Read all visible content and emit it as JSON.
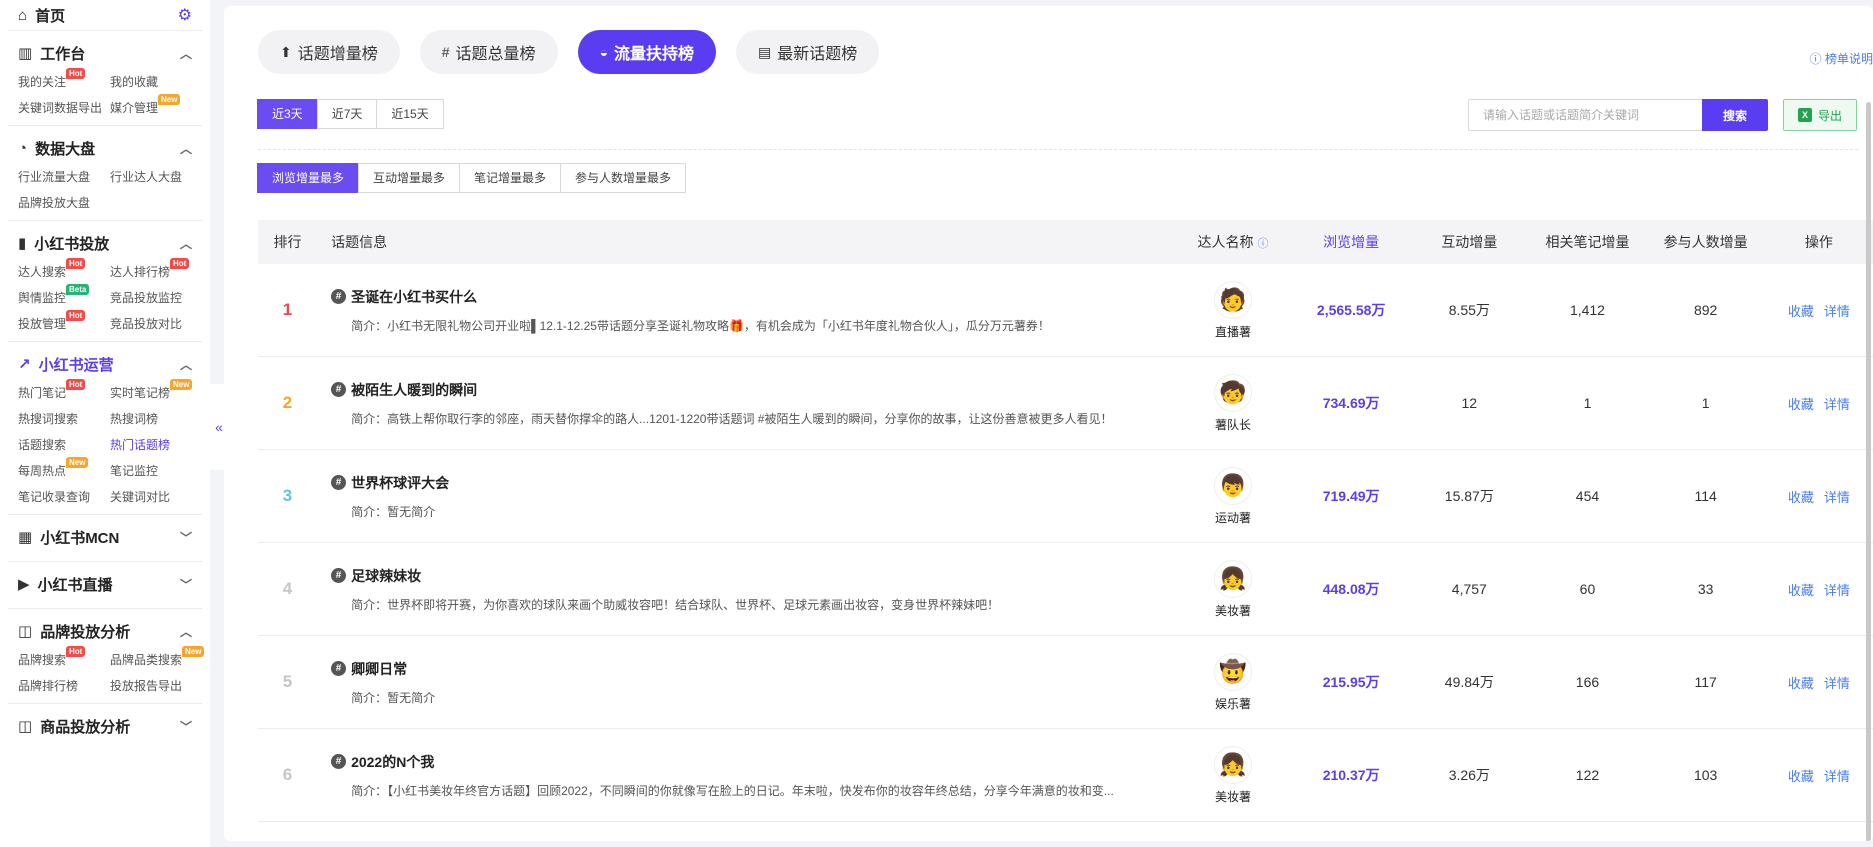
{
  "sidebar": {
    "home": "首页",
    "sections": [
      {
        "title": "工作台",
        "icon": "chart-bars-icon",
        "expanded": true,
        "items": [
          {
            "label": "我的关注",
            "tag": "Hot"
          },
          {
            "label": "我的收藏",
            "tag": ""
          },
          {
            "label": "关键词数据导出",
            "tag": ""
          },
          {
            "label": "媒介管理",
            "tag": "New"
          }
        ]
      },
      {
        "title": "数据大盘",
        "icon": "pie-chart-icon",
        "expanded": true,
        "items": [
          {
            "label": "行业流量大盘",
            "tag": ""
          },
          {
            "label": "行业达人大盘",
            "tag": ""
          },
          {
            "label": "品牌投放大盘",
            "tag": ""
          }
        ]
      },
      {
        "title": "小红书投放",
        "icon": "bar-chart-icon",
        "expanded": true,
        "items": [
          {
            "label": "达人搜索",
            "tag": "Hot"
          },
          {
            "label": "达人排行榜",
            "tag": "Hot"
          },
          {
            "label": "舆情监控",
            "tag": "Beta"
          },
          {
            "label": "竞品投放监控",
            "tag": ""
          },
          {
            "label": "投放管理",
            "tag": "Hot"
          },
          {
            "label": "竞品投放对比",
            "tag": ""
          }
        ]
      },
      {
        "title": "小红书运营",
        "icon": "trend-icon",
        "expanded": true,
        "active": true,
        "items": [
          {
            "label": "热门笔记",
            "tag": "Hot"
          },
          {
            "label": "实时笔记榜",
            "tag": "New"
          },
          {
            "label": "热搜词搜索",
            "tag": ""
          },
          {
            "label": "热搜词榜",
            "tag": ""
          },
          {
            "label": "话题搜索",
            "tag": ""
          },
          {
            "label": "热门话题榜",
            "tag": "",
            "active": true
          },
          {
            "label": "每周热点",
            "tag": "New"
          },
          {
            "label": "笔记监控",
            "tag": ""
          },
          {
            "label": "笔记收录查询",
            "tag": ""
          },
          {
            "label": "关键词对比",
            "tag": ""
          }
        ]
      },
      {
        "title": "小红书MCN",
        "icon": "grid-icon",
        "expanded": false,
        "items": []
      },
      {
        "title": "小红书直播",
        "icon": "video-icon",
        "expanded": false,
        "items": []
      },
      {
        "title": "品牌投放分析",
        "icon": "bag-icon",
        "expanded": true,
        "items": [
          {
            "label": "品牌搜索",
            "tag": "Hot"
          },
          {
            "label": "品牌品类搜索",
            "tag": "New"
          },
          {
            "label": "品牌排行榜",
            "tag": ""
          },
          {
            "label": "投放报告导出",
            "tag": ""
          }
        ]
      },
      {
        "title": "商品投放分析",
        "icon": "shop-icon",
        "expanded": false,
        "items": []
      }
    ]
  },
  "tabs": [
    {
      "label": "话题增量榜",
      "icon": "arrow-up-circle-icon",
      "active": false
    },
    {
      "label": "话题总量榜",
      "icon": "hash-icon",
      "active": false
    },
    {
      "label": "流量扶持榜",
      "icon": "half-circle-icon",
      "active": true
    },
    {
      "label": "最新话题榜",
      "icon": "chat-icon",
      "active": false
    }
  ],
  "rank_help": "榜单说明",
  "day_filters": [
    "近3天",
    "近7天",
    "近15天"
  ],
  "sort_filters": [
    "浏览增量最多",
    "互动增量最多",
    "笔记增量最多",
    "参与人数增量最多"
  ],
  "search": {
    "placeholder": "请输入话题或话题简介关键词",
    "button": "搜索"
  },
  "export_label": "导出",
  "table": {
    "headers": {
      "rank": "排行",
      "topic": "话题信息",
      "user": "达人名称",
      "views": "浏览增量",
      "interact": "互动增量",
      "notes": "相关笔记增量",
      "people": "参与人数增量",
      "op": "操作"
    },
    "ops": {
      "fav": "收藏",
      "detail": "详情"
    },
    "rows": [
      {
        "rank": "1",
        "title": "圣诞在小红书买什么",
        "desc": "简介：小红书无限礼物公司开业啦▌12.1-12.25带话题分享圣诞礼物攻略🎁，有机会成为「小红书年度礼物合伙人」，瓜分万元薯券！",
        "user": "直播薯",
        "avatar": "🧑",
        "views": "2,565.58万",
        "interact": "8.55万",
        "notes": "1,412",
        "people": "892"
      },
      {
        "rank": "2",
        "title": "被陌生人暖到的瞬间",
        "desc": "简介：高铁上帮你取行李的邻座，雨天替你撑伞的路人...1201-1220带话题词 #被陌生人暖到的瞬间，分享你的故事，让这份善意被更多人看见！",
        "user": "薯队长",
        "avatar": "🧒",
        "views": "734.69万",
        "interact": "12",
        "notes": "1",
        "people": "1"
      },
      {
        "rank": "3",
        "title": "世界杯球评大会",
        "desc": "简介：暂无简介",
        "user": "运动薯",
        "avatar": "👦",
        "views": "719.49万",
        "interact": "15.87万",
        "notes": "454",
        "people": "114"
      },
      {
        "rank": "4",
        "title": "足球辣妹妆",
        "desc": "简介：世界杯即将开赛，为你喜欢的球队来画个助威妆容吧！结合球队、世界杯、足球元素画出妆容，变身世界杯辣妹吧！",
        "user": "美妆薯",
        "avatar": "👧",
        "views": "448.08万",
        "interact": "4,757",
        "notes": "60",
        "people": "33"
      },
      {
        "rank": "5",
        "title": "卿卿日常",
        "desc": "简介：暂无简介",
        "user": "娱乐薯",
        "avatar": "🤠",
        "views": "215.95万",
        "interact": "49.84万",
        "notes": "166",
        "people": "117"
      },
      {
        "rank": "6",
        "title": "2022的N个我",
        "desc": "简介：【小红书美妆年终官方话题】回顾2022，不同瞬间的你就像写在脸上的日记。年末啦，快发布你的妆容年终总结，分享今年满意的妆和变...",
        "user": "美妆薯",
        "avatar": "👧",
        "views": "210.37万",
        "interact": "3.26万",
        "notes": "122",
        "people": "103"
      }
    ]
  }
}
